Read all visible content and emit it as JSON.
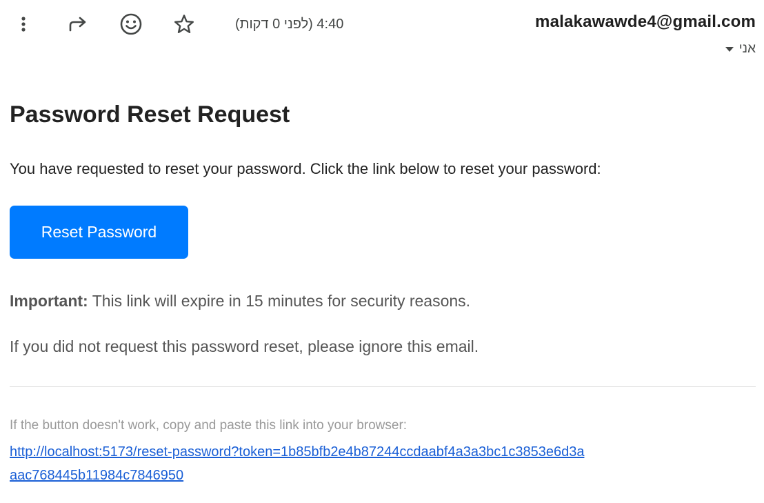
{
  "header": {
    "toolbar": {
      "more_icon": "more-vert-icon",
      "forward_icon": "forward-icon",
      "emoji_icon": "emoji-icon",
      "star_icon": "star-icon"
    },
    "time": "4:40",
    "relative_time": "(לפני 0 דקות)",
    "sender_email": "malakawawde4@gmail.com",
    "recipient_label": "אני"
  },
  "email": {
    "title": "Password Reset Request",
    "intro": "You have requested to reset your password. Click the link below to reset your password:",
    "button_label": "Reset Password",
    "button_color": "#007bff",
    "important_label": "Important:",
    "important_text": " This link will expire in 15 minutes for security reasons.",
    "ignore_text": "If you did not request this password reset, please ignore this email.",
    "fallback_text": "If the button doesn't work, copy and paste this link into your browser:",
    "reset_link": "http://localhost:5173/reset-password?token=1b85bfb2e4b87244ccdaabf4a3a3bc1c3853e6d3aaac768445b11984c7846950"
  }
}
